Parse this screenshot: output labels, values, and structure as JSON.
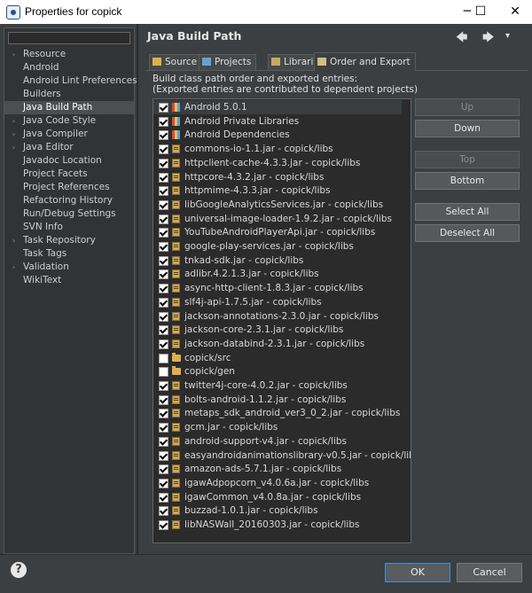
{
  "window": {
    "title": "Properties for copick",
    "controls": [
      "minimize",
      "maximize",
      "close"
    ]
  },
  "sidebar": {
    "filter_value": "",
    "items": [
      {
        "label": "Resource",
        "arrow": true
      },
      {
        "label": "Android",
        "arrow": false
      },
      {
        "label": "Android Lint Preferences",
        "arrow": false
      },
      {
        "label": "Builders",
        "arrow": false
      },
      {
        "label": "Java Build Path",
        "arrow": false,
        "selected": true
      },
      {
        "label": "Java Code Style",
        "arrow": true
      },
      {
        "label": "Java Compiler",
        "arrow": true
      },
      {
        "label": "Java Editor",
        "arrow": true
      },
      {
        "label": "Javadoc Location",
        "arrow": false
      },
      {
        "label": "Project Facets",
        "arrow": false
      },
      {
        "label": "Project References",
        "arrow": false
      },
      {
        "label": "Refactoring History",
        "arrow": false
      },
      {
        "label": "Run/Debug Settings",
        "arrow": false
      },
      {
        "label": "SVN Info",
        "arrow": false
      },
      {
        "label": "Task Repository",
        "arrow": true
      },
      {
        "label": "Task Tags",
        "arrow": false
      },
      {
        "label": "Validation",
        "arrow": true
      },
      {
        "label": "WikiText",
        "arrow": false
      }
    ]
  },
  "header": {
    "title": "Java Build Path",
    "nav": {
      "back": "🡄",
      "forward": "🡆",
      "menu": "▾"
    }
  },
  "tabs": [
    {
      "label": "Source",
      "icon": "source-folder-icon",
      "active": false
    },
    {
      "label": "Projects",
      "icon": "projects-icon",
      "active": false
    },
    {
      "label": "Libraries",
      "icon": "libraries-icon",
      "active": false
    },
    {
      "label": "Order and Export",
      "icon": "order-export-icon",
      "active": true
    }
  ],
  "description": {
    "line1": "Build class path order and exported entries:",
    "line2": "(Exported entries are contributed to dependent projects)"
  },
  "entries": [
    {
      "label": "Android 5.0.1",
      "icon": "lib",
      "checked": true
    },
    {
      "label": "Android Private Libraries",
      "icon": "lib",
      "checked": true
    },
    {
      "label": "Android Dependencies",
      "icon": "lib",
      "checked": true
    },
    {
      "label": "commons-io-1.1.jar - copick/libs",
      "icon": "jar",
      "checked": true
    },
    {
      "label": "httpclient-cache-4.3.3.jar - copick/libs",
      "icon": "jar",
      "checked": true
    },
    {
      "label": "httpcore-4.3.2.jar - copick/libs",
      "icon": "jar",
      "checked": true
    },
    {
      "label": "httpmime-4.3.3.jar - copick/libs",
      "icon": "jar",
      "checked": true
    },
    {
      "label": "libGoogleAnalyticsServices.jar - copick/libs",
      "icon": "jar",
      "checked": true
    },
    {
      "label": "universal-image-loader-1.9.2.jar - copick/libs",
      "icon": "jar",
      "checked": true
    },
    {
      "label": "YouTubeAndroidPlayerApi.jar - copick/libs",
      "icon": "jar",
      "checked": true
    },
    {
      "label": "google-play-services.jar - copick/libs",
      "icon": "jar",
      "checked": true
    },
    {
      "label": "tnkad-sdk.jar - copick/libs",
      "icon": "jar",
      "checked": true
    },
    {
      "label": "adlibr.4.2.1.3.jar - copick/libs",
      "icon": "jar",
      "checked": true
    },
    {
      "label": "async-http-client-1.8.3.jar - copick/libs",
      "icon": "jar",
      "checked": true
    },
    {
      "label": "slf4j-api-1.7.5.jar - copick/libs",
      "icon": "jar",
      "checked": true
    },
    {
      "label": "jackson-annotations-2.3.0.jar - copick/libs",
      "icon": "jar",
      "checked": true
    },
    {
      "label": "jackson-core-2.3.1.jar - copick/libs",
      "icon": "jar",
      "checked": true
    },
    {
      "label": "jackson-databind-2.3.1.jar - copick/libs",
      "icon": "jar",
      "checked": true
    },
    {
      "label": "copick/src",
      "icon": "folder",
      "checked": false
    },
    {
      "label": "copick/gen",
      "icon": "folder",
      "checked": false
    },
    {
      "label": "twitter4j-core-4.0.2.jar - copick/libs",
      "icon": "jar",
      "checked": true
    },
    {
      "label": "bolts-android-1.1.2.jar - copick/libs",
      "icon": "jar",
      "checked": true
    },
    {
      "label": "metaps_sdk_android_ver3_0_2.jar - copick/libs",
      "icon": "jar",
      "checked": true
    },
    {
      "label": "gcm.jar - copick/libs",
      "icon": "jar",
      "checked": true
    },
    {
      "label": "android-support-v4.jar - copick/libs",
      "icon": "jar",
      "checked": true
    },
    {
      "label": "easyandroidanimationslibrary-v0.5.jar - copick/libs",
      "icon": "jar",
      "checked": true
    },
    {
      "label": "amazon-ads-5.7.1.jar - copick/libs",
      "icon": "jar",
      "checked": true
    },
    {
      "label": "igawAdpopcorn_v4.0.6a.jar - copick/libs",
      "icon": "jar",
      "checked": true
    },
    {
      "label": "igawCommon_v4.0.8a.jar - copick/libs",
      "icon": "jar",
      "checked": true
    },
    {
      "label": "buzzad-1.0.1.jar - copick/libs",
      "icon": "jar",
      "checked": true
    },
    {
      "label": "libNASWall_20160303.jar - copick/libs",
      "icon": "jar",
      "checked": true
    }
  ],
  "buttons": {
    "up": "Up",
    "down": "Down",
    "top": "Top",
    "bottom": "Bottom",
    "select_all": "Select All",
    "deselect_all": "Deselect All"
  },
  "footer": {
    "help": "?",
    "ok": "OK",
    "cancel": "Cancel"
  }
}
